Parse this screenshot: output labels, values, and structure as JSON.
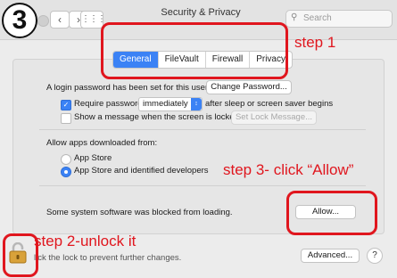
{
  "step_number": "3",
  "window": {
    "title": "Security & Privacy",
    "search_placeholder": "Search"
  },
  "tabs": [
    {
      "label": "General",
      "active": true
    },
    {
      "label": "FileVault",
      "active": false
    },
    {
      "label": "Firewall",
      "active": false
    },
    {
      "label": "Privacy",
      "active": false
    }
  ],
  "general": {
    "password_note": "A login password has been set for this user",
    "change_password_button": "Change Password...",
    "require_password_label": "Require password",
    "require_password_checked": true,
    "require_password_value": "immediately",
    "require_password_suffix": "after sleep or screen saver begins",
    "show_message_label": "Show a message when the screen is locked",
    "show_message_checked": false,
    "set_lock_message_button": "Set Lock Message..."
  },
  "downloads": {
    "heading": "Allow apps downloaded from:",
    "options": [
      {
        "label": "App Store",
        "selected": false
      },
      {
        "label": "App Store and identified developers",
        "selected": true
      }
    ]
  },
  "blocked": {
    "message": "Some system software was blocked from loading.",
    "allow_button": "Allow..."
  },
  "footer": {
    "lock_text": "lick the lock to prevent further changes.",
    "advanced_button": "Advanced...",
    "help_button": "?"
  },
  "annotations": {
    "step1": "step 1",
    "step2": "step 2-unlock it",
    "step3": "step 3- click “Allow”"
  },
  "colors": {
    "accent": "#3b82f5",
    "annotation_red": "#e0161e"
  },
  "icons": [
    "lock-icon",
    "search-icon",
    "grid-icon",
    "chevron-left-icon",
    "chevron-right-icon",
    "checkmark-icon",
    "chevron-updown-icon"
  ]
}
